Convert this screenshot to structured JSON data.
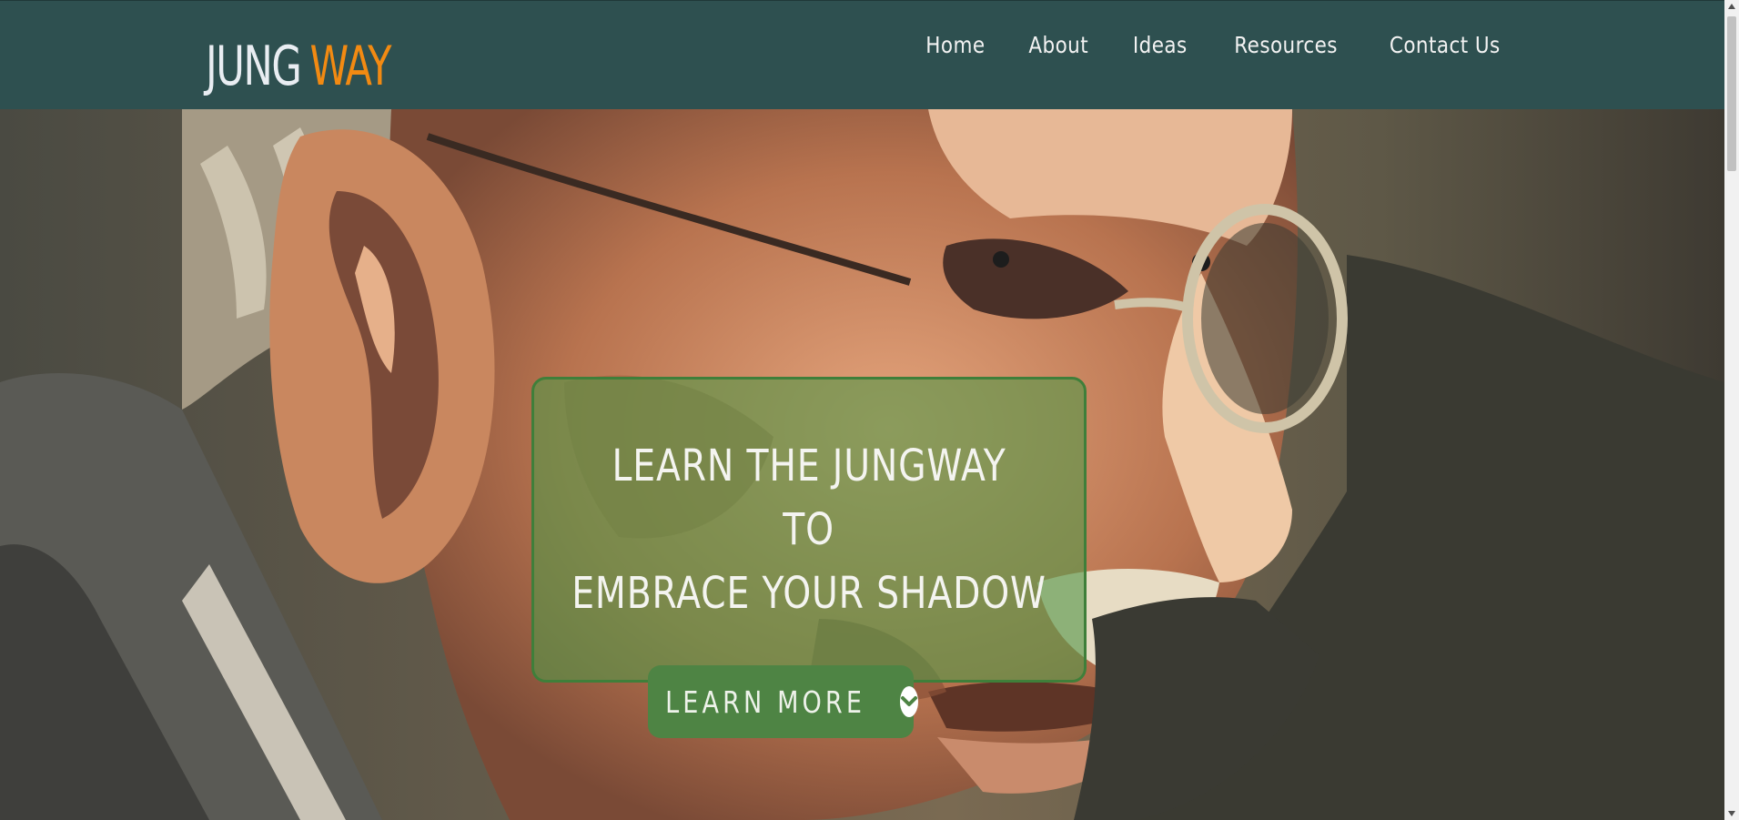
{
  "brand": {
    "part1": "JUNG",
    "part2": "WAY"
  },
  "nav": {
    "items": [
      {
        "label": "Home"
      },
      {
        "label": "About"
      },
      {
        "label": "Ideas"
      },
      {
        "label": "Resources"
      },
      {
        "label": "Contact Us"
      }
    ]
  },
  "hero": {
    "line1": "LEARN THE JUNGWAY",
    "line2": "TO",
    "line3": "EMBRACE YOUR SHADOW",
    "cta_label": "LEARN MORE",
    "cta_icon": "chevron-down-circle-icon",
    "image": "illustrated portrait of an older man with glasses"
  },
  "colors": {
    "navbar": "#2e5050",
    "logo_accent": "#f28a12",
    "headline_box": "#569648",
    "cta": "#4e8444"
  }
}
